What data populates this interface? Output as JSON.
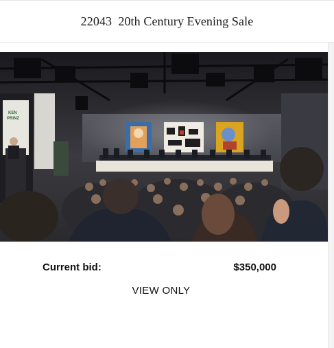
{
  "sale": {
    "title": "22043  20th Century Evening Sale"
  },
  "video": {
    "description_icon": "auction-livestream",
    "lectern_sign": "KEN PRINZ"
  },
  "bid": {
    "label": "Current bid:",
    "value": "$350,000"
  },
  "status": {
    "text": "VIEW ONLY"
  }
}
